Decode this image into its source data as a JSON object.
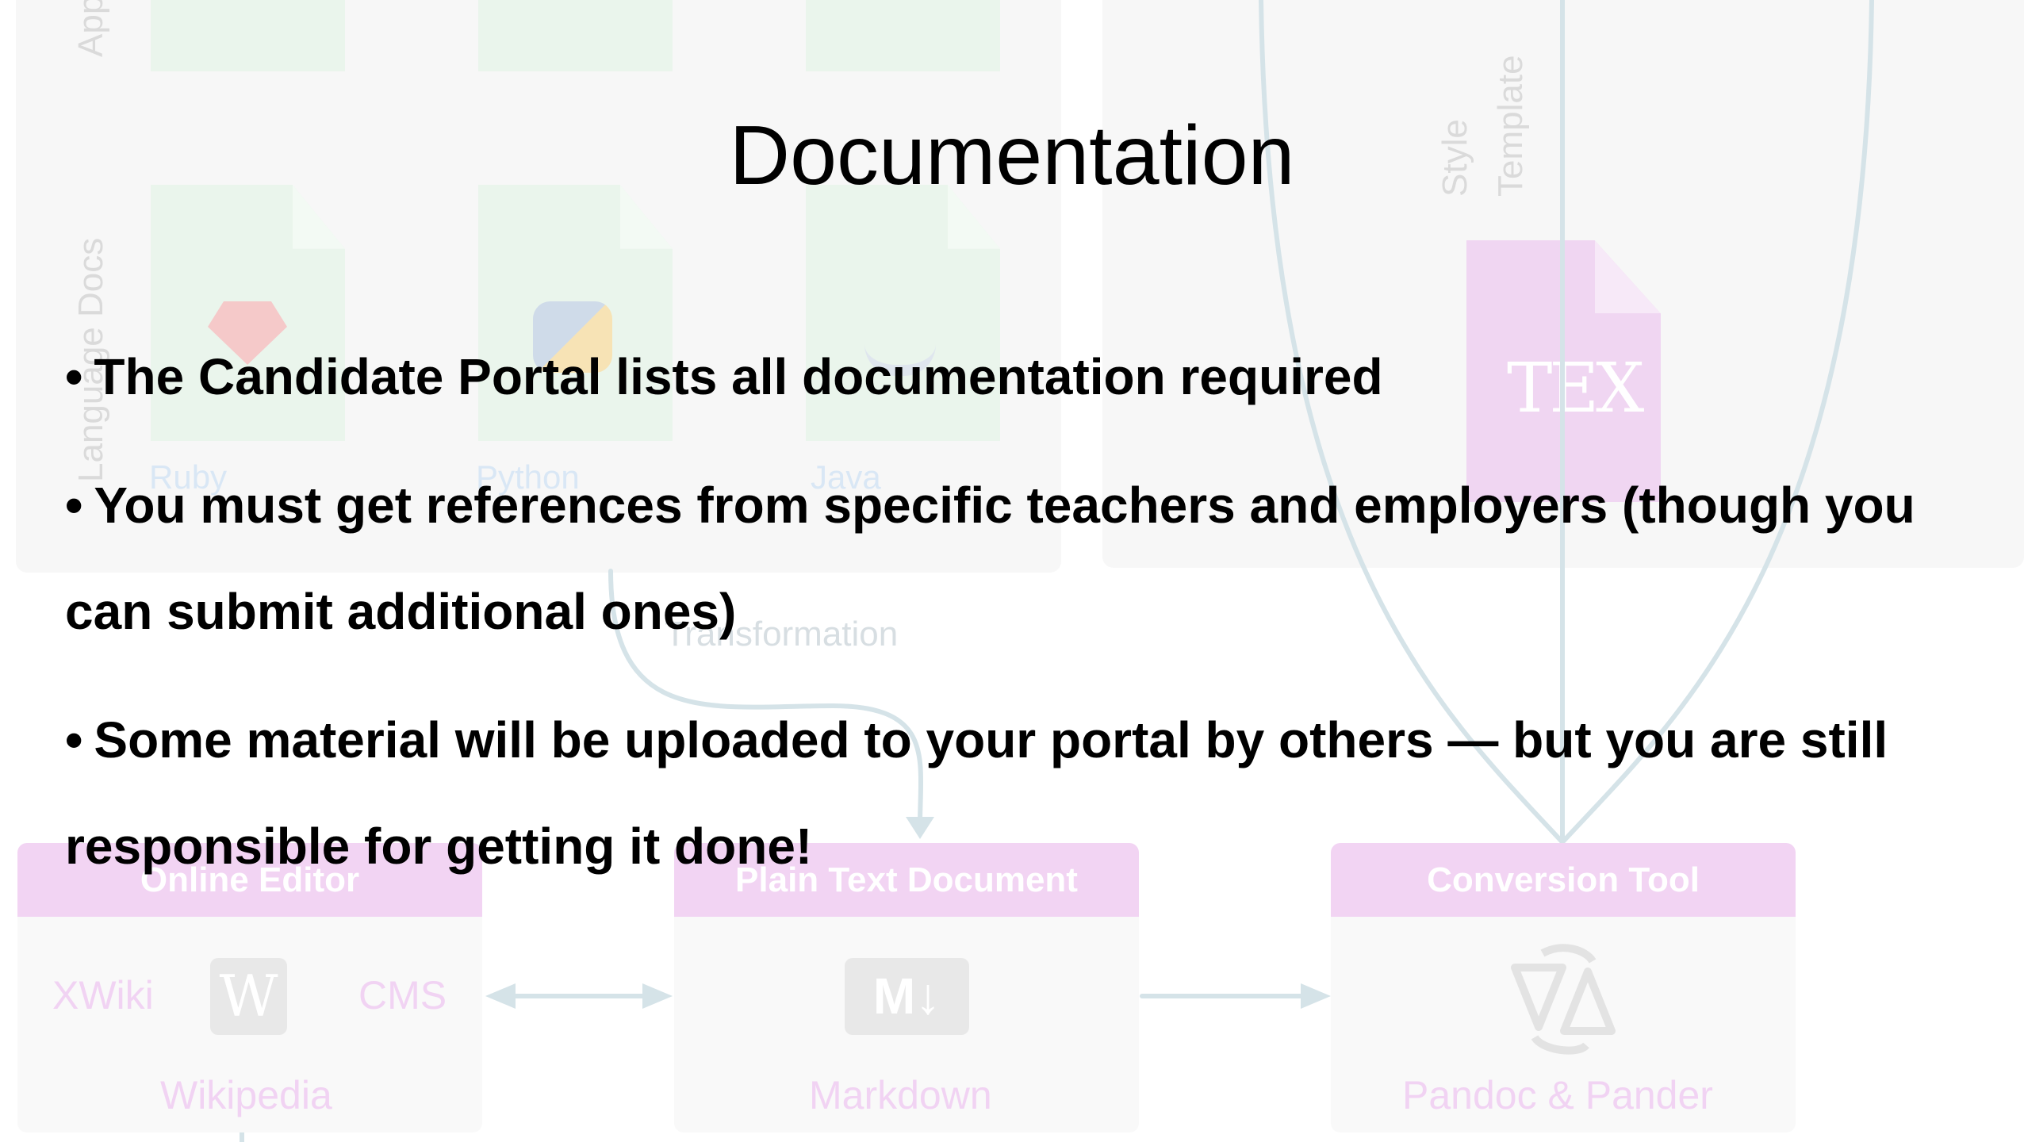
{
  "slide": {
    "title": "Documentation",
    "bullets": [
      "The Candidate Portal lists all documentation required",
      "You must get references from specific teachers and employers (though you can submit additional ones)",
      "Some material will be uploaded to your portal by others — but you are still responsible for getting it done!"
    ],
    "bullet_glyph": "•"
  },
  "background_diagram": {
    "labels": {
      "apps": "Apps",
      "language_docs": "Language Docs",
      "style": "Style",
      "template": "Template",
      "transformation": "Transformation"
    },
    "languages": [
      "Ruby",
      "Python",
      "Java"
    ],
    "tex_logo": "TEX",
    "boxes": [
      {
        "title": "Online Editor",
        "items": [
          "XWiki",
          "CMS",
          "Wikipedia"
        ],
        "icon": "wikipedia-icon",
        "icon_text": "W"
      },
      {
        "title": "Plain Text Document",
        "items": [
          "Markdown"
        ],
        "icon": "markdown-icon",
        "icon_text": "M↓"
      },
      {
        "title": "Conversion Tool",
        "items": [
          "Pandoc & Pander"
        ],
        "icon": "conversion-icon"
      }
    ],
    "colors": {
      "panel": "#f7f7f7",
      "doc_tile": "#eaf5ec",
      "pink": "#f2d4f3",
      "line": "#d5e3e8"
    }
  }
}
